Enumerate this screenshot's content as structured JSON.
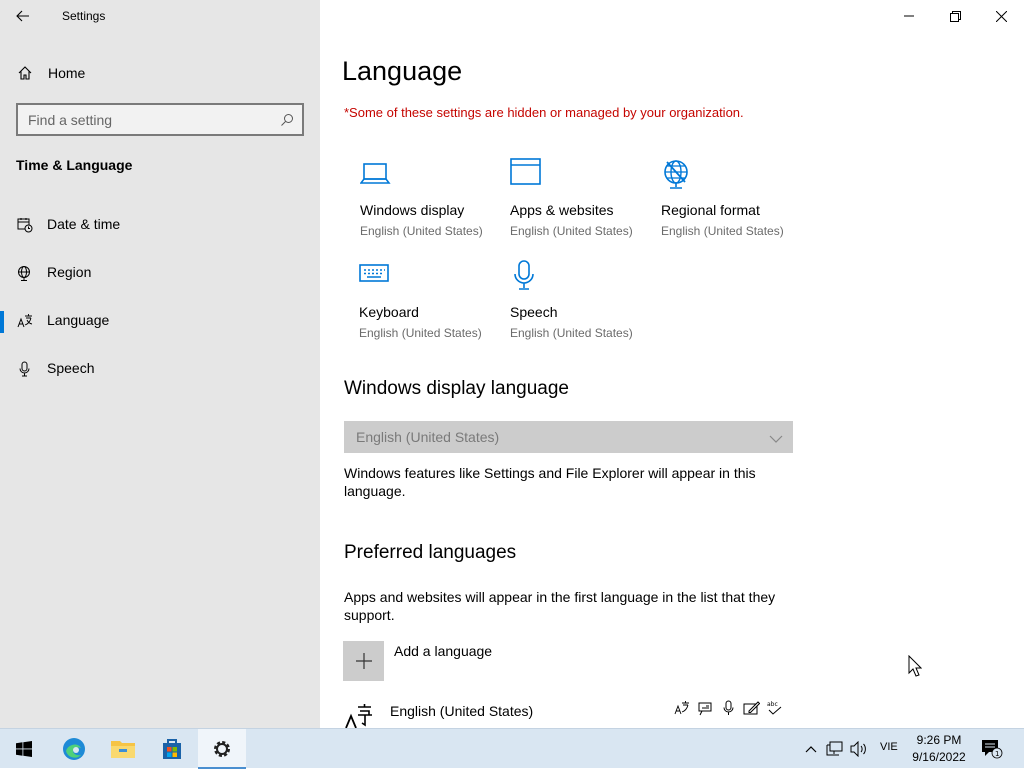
{
  "window": {
    "title": "Settings",
    "controls": [
      "minimize-icon",
      "restore-icon",
      "close-icon"
    ]
  },
  "sidebar": {
    "home_label": "Home",
    "search_placeholder": "Find a setting",
    "section_title": "Time & Language",
    "items": [
      {
        "label": "Date & time",
        "icon": "calendar-clock-icon"
      },
      {
        "label": "Region",
        "icon": "globe-icon"
      },
      {
        "label": "Language",
        "icon": "language-icon",
        "active": true
      },
      {
        "label": "Speech",
        "icon": "microphone-icon"
      }
    ]
  },
  "main": {
    "title": "Language",
    "warning": "*Some of these settings are hidden or managed by your organization.",
    "tiles": [
      {
        "title": "Windows display",
        "subtitle": "English (United States)",
        "icon": "laptop-icon"
      },
      {
        "title": "Apps & websites",
        "subtitle": "English (United States)",
        "icon": "window-icon"
      },
      {
        "title": "Regional format",
        "subtitle": "English (United States)",
        "icon": "regional-globe-icon"
      },
      {
        "title": "Keyboard",
        "subtitle": "English (United States)",
        "icon": "keyboard-icon"
      },
      {
        "title": "Speech",
        "subtitle": "English (United States)",
        "icon": "microphone-icon"
      }
    ],
    "display_language": {
      "heading": "Windows display language",
      "selected": "English (United States)",
      "description": "Windows features like Settings and File Explorer will appear in this language."
    },
    "preferred": {
      "heading": "Preferred languages",
      "description": "Apps and websites will appear in the first language in the list that they support.",
      "add_label": "Add a language",
      "languages": [
        {
          "name": "English (United States)",
          "features": [
            "display-language-icon",
            "text-to-speech-icon",
            "speech-icon",
            "handwriting-icon",
            "spelling-icon"
          ]
        }
      ]
    }
  },
  "taskbar": {
    "apps": [
      "windows-start-icon",
      "edge-icon",
      "file-explorer-icon",
      "store-icon",
      "settings-icon"
    ],
    "tray": [
      "chevron-up-icon",
      "network-icon",
      "volume-icon"
    ],
    "input_language": "VIE",
    "time": "9:26 PM",
    "date": "9/16/2022",
    "notification_count": "1"
  },
  "colors": {
    "accent": "#0078d7",
    "warning": "#c50500",
    "sidebar_bg": "#e6e6e6",
    "taskbar_bg": "#d9e6f2"
  }
}
